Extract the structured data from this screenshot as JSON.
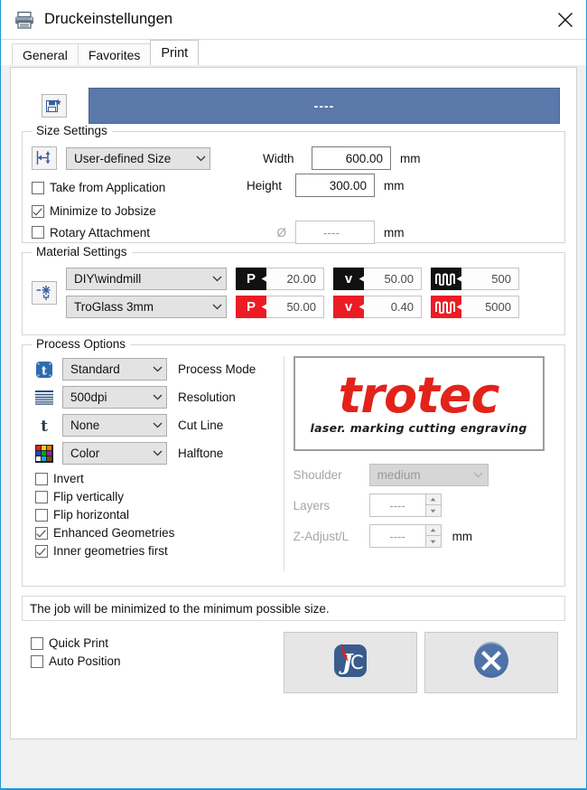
{
  "window": {
    "title": "Druckeinstellungen",
    "printer_icon": "printer-icon",
    "close_icon": "close-icon"
  },
  "tabs": [
    {
      "label": "General",
      "active": false
    },
    {
      "label": "Favorites",
      "active": false
    },
    {
      "label": "Print",
      "active": true
    }
  ],
  "preset": {
    "save_icon": "save-preset-icon",
    "value": "----",
    "bar_color": "#5b78ab"
  },
  "size_settings": {
    "legend": "Size Settings",
    "icon": "resize-icon",
    "size_mode": "User-defined Size",
    "width_label": "Width",
    "width_value": "600.00",
    "width_unit": "mm",
    "height_label": "Height",
    "height_value": "300.00",
    "height_unit": "mm",
    "diameter_symbol": "Ø",
    "diameter_value": "----",
    "diameter_unit": "mm",
    "checkboxes": [
      {
        "label": "Take from Application",
        "checked": false
      },
      {
        "label": "Minimize to Jobsize",
        "checked": true
      },
      {
        "label": "Rotary Attachment",
        "checked": false
      }
    ]
  },
  "material_settings": {
    "legend": "Material Settings",
    "icon": "material-icon",
    "rows": [
      {
        "material": "DIY\\windmill",
        "color": "#111111",
        "power": "20.00",
        "velocity": "50.00",
        "frequency": "500"
      },
      {
        "material": "TroGlass 3mm",
        "color": "#ec1c24",
        "power": "50.00",
        "velocity": "0.40",
        "frequency": "5000"
      }
    ],
    "badge_power": "P",
    "badge_velocity": "v",
    "badge_frequency": "frequency-wave-icon"
  },
  "process_options": {
    "legend": "Process Options",
    "fields": [
      {
        "icon": "process-mode-icon",
        "value": "Standard",
        "label": "Process Mode"
      },
      {
        "icon": "resolution-lines-icon",
        "value": "500dpi",
        "label": "Resolution"
      },
      {
        "icon": "cut-line-icon",
        "value": "None",
        "label": "Cut Line"
      },
      {
        "icon": "halftone-color-grid-icon",
        "value": "Color",
        "label": "Halftone"
      }
    ],
    "checkboxes": [
      {
        "label": "Invert",
        "checked": false
      },
      {
        "label": "Flip vertically",
        "checked": false
      },
      {
        "label": "Flip horizontal",
        "checked": false
      },
      {
        "label": "Enhanced Geometries",
        "checked": true
      },
      {
        "label": "Inner geometries first",
        "checked": true
      }
    ],
    "logo": {
      "word": "trotec",
      "tagline": "laser. marking cutting engraving",
      "color": "#e2231a"
    },
    "shoulder_label": "Shoulder",
    "shoulder_value": "medium",
    "layers_label": "Layers",
    "layers_value": "----",
    "zadjust_label": "Z-Adjust/L",
    "zadjust_value": "----",
    "zadjust_unit": "mm"
  },
  "status": {
    "message": "The job will be minimized to the minimum possible size."
  },
  "footer": {
    "checkboxes": [
      {
        "label": "Quick Print",
        "checked": false
      },
      {
        "label": "Auto Position",
        "checked": false
      }
    ],
    "jobcontrol_button_icon": "jobcontrol-jc-icon",
    "cancel_button_icon": "cancel-circle-x-icon"
  }
}
